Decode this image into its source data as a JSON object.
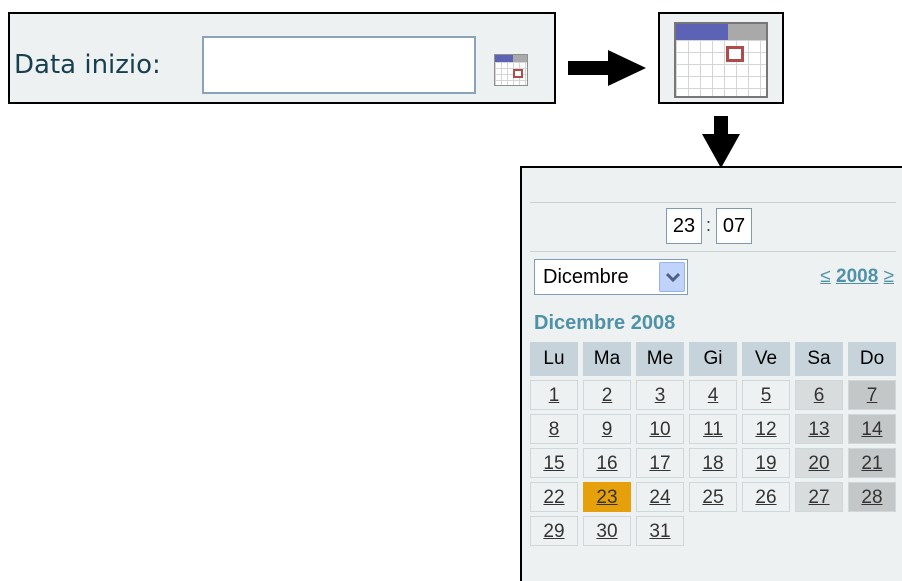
{
  "form": {
    "label": "Data inizio:",
    "input_value": "",
    "icon": "calendar-icon"
  },
  "arrows": {
    "right_icon": "arrow-right-icon",
    "down_icon": "arrow-down-icon"
  },
  "calendar_popup": {
    "time": {
      "hour": "23",
      "minute": "07",
      "separator": ":"
    },
    "month_select": "Dicembre",
    "year_nav": {
      "prev": "≤",
      "year": "2008",
      "next": "≥"
    },
    "month_title": "Dicembre 2008",
    "weekdays": [
      "Lu",
      "Ma",
      "Me",
      "Gi",
      "Ve",
      "Sa",
      "Do"
    ],
    "weeks": [
      [
        "1",
        "2",
        "3",
        "4",
        "5",
        "6",
        "7"
      ],
      [
        "8",
        "9",
        "10",
        "11",
        "12",
        "13",
        "14"
      ],
      [
        "15",
        "16",
        "17",
        "18",
        "19",
        "20",
        "21"
      ],
      [
        "22",
        "23",
        "24",
        "25",
        "26",
        "27",
        "28"
      ],
      [
        "29",
        "30",
        "31",
        "",
        "",
        "",
        ""
      ]
    ],
    "selected_day": "23"
  },
  "colors": {
    "today": "#e5a00b",
    "accent_link": "#4f92a8",
    "weekday_header": "#c6d3da",
    "saturday": "#d9dcdd",
    "sunday": "#c4c7c8"
  }
}
